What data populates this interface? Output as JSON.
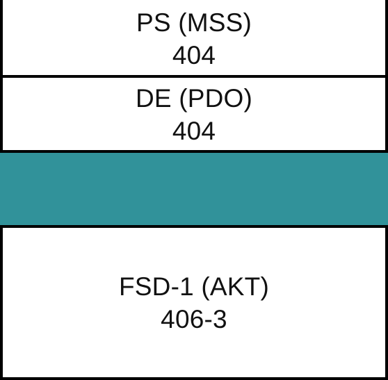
{
  "diagram": {
    "colors": {
      "border": "#000000",
      "band": "#31929A",
      "background": "#FFFFFF",
      "text": "#111111"
    },
    "blocks": [
      {
        "title": "PS (MSS)",
        "value": "404"
      },
      {
        "title": "DE (PDO)",
        "value": "404"
      },
      {
        "title": "",
        "value": ""
      },
      {
        "title": "FSD-1 (AKT)",
        "value": "406-3"
      }
    ]
  }
}
